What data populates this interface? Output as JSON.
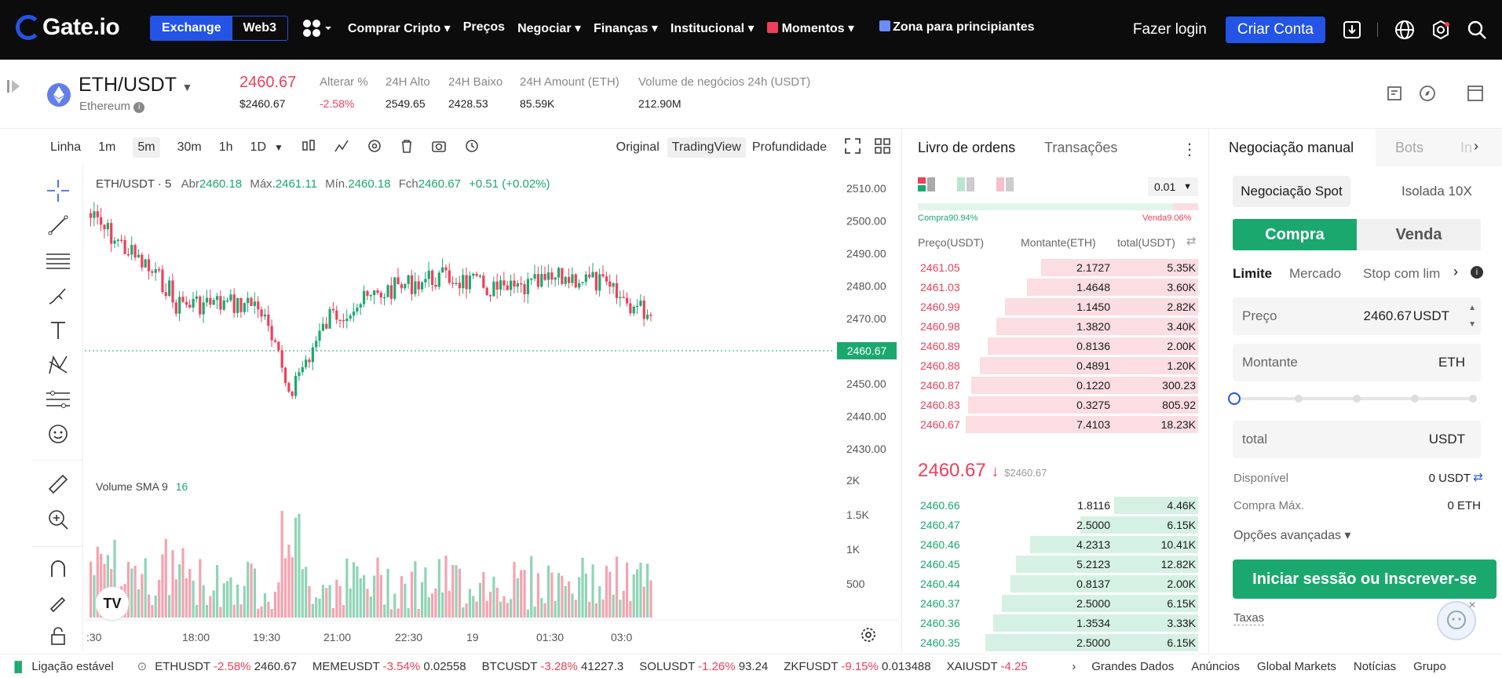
{
  "nav": {
    "logo": "Gate.io",
    "seg_exchange": "Exchange",
    "seg_web3": "Web3",
    "links": [
      "Comprar Cripto ▾",
      "Preços",
      "Negociar ▾",
      "Finanças ▾",
      "Institucional ▾",
      "Momentos ▾",
      "Zona para principiantes"
    ],
    "login": "Fazer login",
    "signup": "Criar Conta"
  },
  "pair": {
    "name": "ETH/USDT",
    "sub": "Ethereum",
    "price": "2460.67",
    "price_usd": "$2460.67",
    "stats": [
      {
        "label": "Alterar %",
        "value": "-2.58%"
      },
      {
        "label": "24H Alto",
        "value": "2549.65"
      },
      {
        "label": "24H Baixo",
        "value": "2428.53"
      },
      {
        "label": "24H Amount (ETH)",
        "value": "85.59K"
      },
      {
        "label": "Volume de negócios 24h (USDT)",
        "value": "212.90M"
      }
    ]
  },
  "toolbar": {
    "intervals": [
      "Linha",
      "1m",
      "5m",
      "30m",
      "1h",
      "1D"
    ],
    "views": [
      "Original",
      "TradingView",
      "Profundidade"
    ]
  },
  "chart_legend": {
    "symbol": "ETH/USDT · 5",
    "o_label": "Abr",
    "o": "2460.18",
    "h_label": "Máx.",
    "h": "2461.11",
    "l_label": "Mín.",
    "l": "2460.18",
    "c_label": "Fch",
    "c": "2460.67",
    "chg": "+0.51 (+0.02%)",
    "vol_label": "Volume SMA 9",
    "vol_val": "16",
    "last_price": "2460.67"
  },
  "chart_data": {
    "type": "candlestick",
    "price_ticks": [
      "2510.00",
      "2500.00",
      "2490.00",
      "2480.00",
      "2470.00",
      "2460.00",
      "2450.00",
      "2440.00",
      "2430.00"
    ],
    "volume_ticks": [
      "2K",
      "1.5K",
      "1K",
      "500"
    ],
    "time_ticks": [
      ":30",
      "18:00",
      "19:30",
      "21:00",
      "22:30",
      "19",
      "01:30",
      "03:0"
    ]
  },
  "orderbook": {
    "tab1": "Livro de ordens",
    "tab2": "Transações",
    "precision": "0.01",
    "buy_pct": "Compra90.94%",
    "sell_pct": "Venda9.06%",
    "cols": [
      "Preço(USDT)",
      "Montante(ETH)",
      "total(USDT)"
    ],
    "asks": [
      [
        "2461.05",
        "2.1727",
        "5.35K",
        0.56
      ],
      [
        "2461.03",
        "1.4648",
        "3.60K",
        0.61
      ],
      [
        "2460.99",
        "1.1450",
        "2.82K",
        0.69
      ],
      [
        "2460.98",
        "1.3820",
        "3.40K",
        0.72
      ],
      [
        "2460.89",
        "0.8136",
        "2.00K",
        0.75
      ],
      [
        "2460.88",
        "0.4891",
        "1.20K",
        0.78
      ],
      [
        "2460.87",
        "0.1220",
        "300.23",
        0.81
      ],
      [
        "2460.83",
        "0.3275",
        "805.92",
        0.82
      ],
      [
        "2460.67",
        "7.4103",
        "18.23K",
        0.83
      ]
    ],
    "mid": "2460.67",
    "mid_usd": "$2460.67",
    "bids": [
      [
        "2460.66",
        "1.8116",
        "4.46K",
        0.3
      ],
      [
        "2460.47",
        "2.5000",
        "6.15K",
        0.42
      ],
      [
        "2460.46",
        "4.2313",
        "10.41K",
        0.6
      ],
      [
        "2460.45",
        "5.2123",
        "12.82K",
        0.65
      ],
      [
        "2460.44",
        "0.8137",
        "2.00K",
        0.67
      ],
      [
        "2460.37",
        "2.5000",
        "6.15K",
        0.7
      ],
      [
        "2460.36",
        "1.3534",
        "3.33K",
        0.73
      ],
      [
        "2460.35",
        "2.5000",
        "6.15K",
        0.76
      ]
    ]
  },
  "trade": {
    "tab1": "Negociação manual",
    "tab2": "Bots",
    "tab3": "In",
    "spot": "Negociação Spot",
    "isolated": "Isolada 10X",
    "buy": "Compra",
    "sell": "Venda",
    "types": [
      "Limite",
      "Mercado",
      "Stop com lim"
    ],
    "price_label": "Preço",
    "price_val": "2460.67",
    "price_unit": "USDT",
    "amount_label": "Montante",
    "amount_unit": "ETH",
    "slider_level": 0,
    "total_label": "total",
    "total_unit": "USDT",
    "avail_label": "Disponível",
    "avail_val": "0 USDT",
    "max_label": "Compra Máx.",
    "max_val": "0 ETH",
    "adv": "Opções avançadas ▾",
    "cta": "Iniciar sessão ou Inscrever-se",
    "fees": "Taxas"
  },
  "footer": {
    "status": "Ligação estável",
    "tickers": [
      {
        "sym": "ETHUSDT",
        "chg": "-2.58%",
        "price": "2460.67"
      },
      {
        "sym": "MEMEUSDT",
        "chg": "-3.54%",
        "price": "0.02558"
      },
      {
        "sym": "BTCUSDT",
        "chg": "-3.28%",
        "price": "41227.3"
      },
      {
        "sym": "SOLUSDT",
        "chg": "-1.26%",
        "price": "93.24"
      },
      {
        "sym": "ZKFUSDT",
        "chg": "-9.15%",
        "price": "0.013488"
      },
      {
        "sym": "XAIUSDT",
        "chg": "-4.25",
        "price": ""
      }
    ],
    "links": [
      "Grandes Dados",
      "Anúncios",
      "Global Markets",
      "Notícias",
      "Grupo"
    ]
  },
  "colors": {
    "accent": "#2354e6",
    "up": "#1ba86f",
    "down": "#ef3f5a"
  }
}
